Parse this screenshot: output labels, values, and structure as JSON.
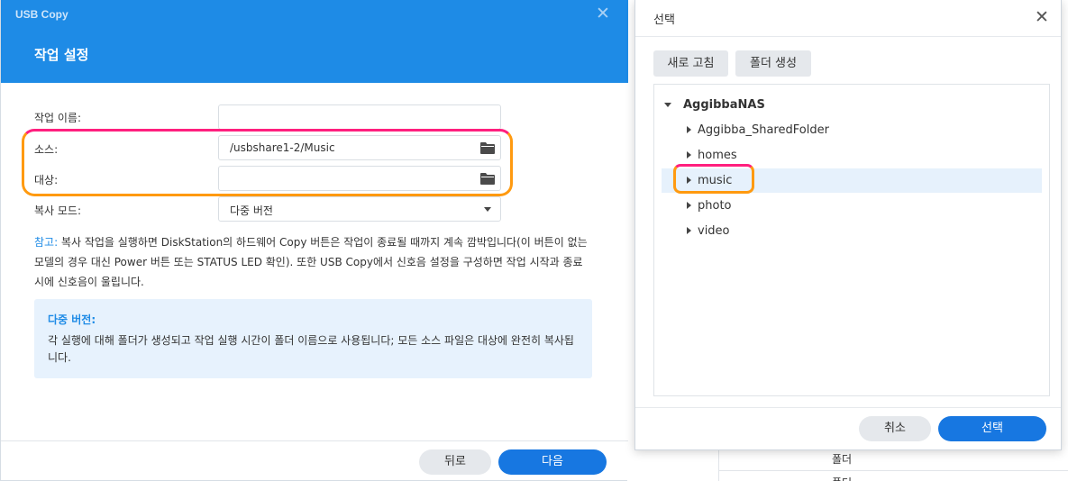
{
  "main": {
    "app_title": "USB Copy",
    "close_glyph": "✕",
    "wizard_title": "작업 설정",
    "fields": {
      "task_name_label": "작업 이름:",
      "task_name_value": "",
      "source_label": "소스:",
      "source_value": "/usbshare1-2/Music",
      "destination_label": "대상:",
      "destination_value": "",
      "copy_mode_label": "복사 모드:",
      "copy_mode_value": "다중 버전"
    },
    "note_label": "참고:",
    "note_text": " 복사 작업을 실행하면 DiskStation의 하드웨어 Copy 버튼은 작업이 종료될 때까지 계속 깜박입니다(이 버튼이 없는 모델의 경우 대신 Power 버튼 또는 STATUS LED 확인). 또한 USB Copy에서 신호음 설정을 구성하면 작업 시작과 종료 시에 신호음이 울립니다.",
    "info_title": "다중 버전:",
    "info_text": "각 실행에 대해 폴더가 생성되고 작업 실행 시간이 폴더 이름으로 사용됩니다; 모든 소스 파일은 대상에 완전히 복사됩니다.",
    "back_button": "뒤로",
    "next_button": "다음"
  },
  "background": {
    "partial_text_1": "폴더",
    "partial_text_2": "폴더"
  },
  "select_dialog": {
    "title": "선택",
    "close_glyph": "✕",
    "refresh_button": "새로 고침",
    "create_folder_button": "폴더 생성",
    "tree": {
      "root": "AggibbaNAS",
      "children": [
        "Aggibba_SharedFolder",
        "homes",
        "music",
        "photo",
        "video"
      ],
      "selected": "music"
    },
    "cancel_button": "취소",
    "select_button": "선택"
  },
  "colors": {
    "accent": "#1e8be6",
    "button_blue": "#1777e1",
    "highlight_pink": "#ff1f7e",
    "highlight_orange": "#ff9a10"
  },
  "icons": [
    "close-icon",
    "folder-icon",
    "chevron-down-icon",
    "caret-right-icon",
    "caret-down-icon"
  ]
}
